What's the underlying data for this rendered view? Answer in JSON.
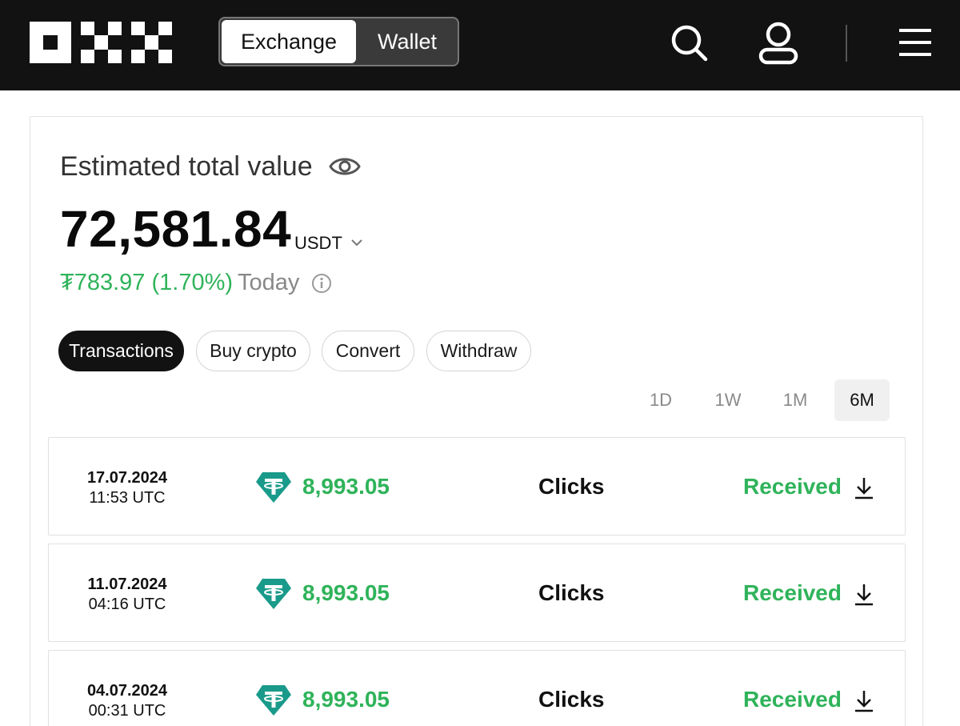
{
  "header": {
    "logo_icon": "okx-logo",
    "tabs": [
      {
        "label": "Exchange",
        "active": true
      },
      {
        "label": "Wallet",
        "active": false
      }
    ],
    "icons": [
      "search-icon",
      "user-icon",
      "menu-icon"
    ]
  },
  "summary": {
    "label": "Estimated total value",
    "value": "72,581.84",
    "currency": "USDT",
    "change": "₮783.97 (1.70%)",
    "change_period": "Today"
  },
  "actions": [
    {
      "label": "Transactions",
      "active": true
    },
    {
      "label": "Buy crypto",
      "active": false
    },
    {
      "label": "Convert",
      "active": false
    },
    {
      "label": "Withdraw",
      "active": false
    }
  ],
  "ranges": [
    {
      "label": "1D",
      "active": false
    },
    {
      "label": "1W",
      "active": false
    },
    {
      "label": "1M",
      "active": false
    },
    {
      "label": "6M",
      "active": true
    }
  ],
  "transactions": [
    {
      "date": "17.07.2024",
      "time": "11:53 UTC",
      "amount": "8,993.05",
      "source": "Clicks",
      "status": "Received"
    },
    {
      "date": "11.07.2024",
      "time": "04:16 UTC",
      "amount": "8,993.05",
      "source": "Clicks",
      "status": "Received"
    },
    {
      "date": "04.07.2024",
      "time": "00:31 UTC",
      "amount": "8,993.05",
      "source": "Clicks",
      "status": "Received"
    }
  ],
  "colors": {
    "header_bg": "#121212",
    "positive": "#2fb35a",
    "tether": "#1a9a8a"
  }
}
